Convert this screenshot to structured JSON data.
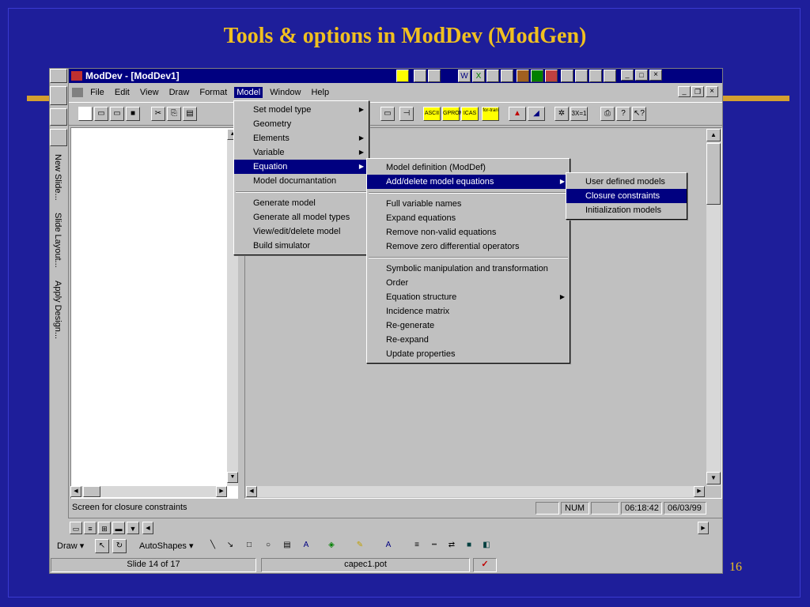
{
  "slide": {
    "title": "Tools & options in  ModDev (ModGen)",
    "page_number": "16"
  },
  "app": {
    "title": "ModDev - [ModDev1]",
    "menu": [
      "File",
      "Edit",
      "View",
      "Draw",
      "Format",
      "Model",
      "Window",
      "Help"
    ],
    "active_menu": "Model"
  },
  "model_menu": {
    "items": [
      {
        "label": "Set model type",
        "submenu": true
      },
      {
        "label": "Geometry",
        "submenu": false
      },
      {
        "label": "Elements",
        "submenu": true
      },
      {
        "label": "Variable",
        "submenu": true
      },
      {
        "label": "Equation",
        "submenu": true,
        "selected": true
      },
      {
        "label": "Model documantation",
        "submenu": false
      },
      {
        "label": "Generate model",
        "submenu": false
      },
      {
        "label": "Generate all model types",
        "submenu": false
      },
      {
        "label": "View/edit/delete model",
        "submenu": false
      },
      {
        "label": "Build simulator",
        "submenu": false
      }
    ]
  },
  "equation_menu": {
    "items": [
      {
        "label": "Model definition (ModDef)"
      },
      {
        "label": "Add/delete model equations",
        "selected": true
      },
      {
        "label": "Full variable names"
      },
      {
        "label": "Expand equations"
      },
      {
        "label": "Remove non-valid equations"
      },
      {
        "label": "Remove zero differential operators"
      },
      {
        "label": "Symbolic manipulation and transformation"
      },
      {
        "label": "Order"
      },
      {
        "label": "Equation structure",
        "submenu": true
      },
      {
        "label": "Incidence matrix"
      },
      {
        "label": "Re-generate"
      },
      {
        "label": "Re-expand"
      },
      {
        "label": "Update properties"
      }
    ]
  },
  "add_delete_menu": {
    "items": [
      {
        "label": "User defined models"
      },
      {
        "label": "Closure constraints",
        "selected": true
      },
      {
        "label": "Initialization models"
      }
    ]
  },
  "toolbar_labels": {
    "ascii": "ASCII",
    "gproms": "GPROM",
    "icas": "ICAS",
    "fortran": "for-tran",
    "cvt": "3X=1"
  },
  "side_tabs": [
    "New Slide...",
    "Slide Layout...",
    "Apply Design..."
  ],
  "status": {
    "message": "Screen for closure constraints",
    "num": "NUM",
    "time": "06:18:42",
    "date": "06/03/99"
  },
  "draw_toolbar": {
    "draw": "Draw",
    "autoshapes": "AutoShapes"
  },
  "ppt_status": {
    "slide": "Slide 14 of 17",
    "template": "capec1.pot"
  },
  "colors": {
    "slide_bg": "#1e1e9a",
    "title": "#f0c020",
    "selection": "#000080"
  }
}
